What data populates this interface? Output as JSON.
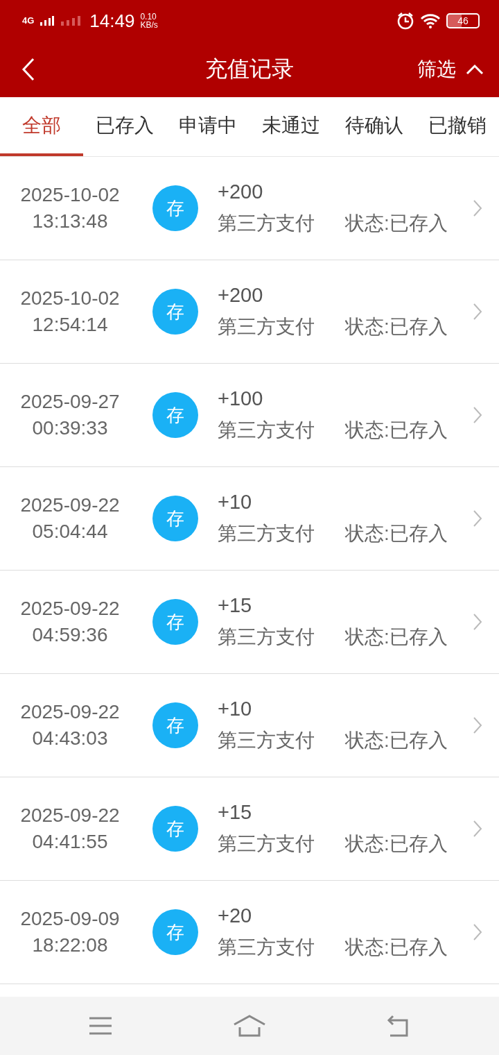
{
  "status_bar": {
    "network": "4G",
    "time": "14:49",
    "speed_value": "0.10",
    "speed_unit": "KB/s",
    "battery": "46"
  },
  "header": {
    "title": "充值记录",
    "filter": "筛选"
  },
  "tabs": [
    {
      "label": "全部",
      "selected": true
    },
    {
      "label": "已存入",
      "selected": false
    },
    {
      "label": "申请中",
      "selected": false
    },
    {
      "label": "未通过",
      "selected": false
    },
    {
      "label": "待确认",
      "selected": false
    },
    {
      "label": "已撤销",
      "selected": false
    }
  ],
  "records": [
    {
      "date": "2025-10-02",
      "time": "13:13:48",
      "badge": "存",
      "amount": "+200",
      "method": "第三方支付",
      "status": "状态:已存入"
    },
    {
      "date": "2025-10-02",
      "time": "12:54:14",
      "badge": "存",
      "amount": "+200",
      "method": "第三方支付",
      "status": "状态:已存入"
    },
    {
      "date": "2025-09-27",
      "time": "00:39:33",
      "badge": "存",
      "amount": "+100",
      "method": "第三方支付",
      "status": "状态:已存入"
    },
    {
      "date": "2025-09-22",
      "time": "05:04:44",
      "badge": "存",
      "amount": "+10",
      "method": "第三方支付",
      "status": "状态:已存入"
    },
    {
      "date": "2025-09-22",
      "time": "04:59:36",
      "badge": "存",
      "amount": "+15",
      "method": "第三方支付",
      "status": "状态:已存入"
    },
    {
      "date": "2025-09-22",
      "time": "04:43:03",
      "badge": "存",
      "amount": "+10",
      "method": "第三方支付",
      "status": "状态:已存入"
    },
    {
      "date": "2025-09-22",
      "time": "04:41:55",
      "badge": "存",
      "amount": "+15",
      "method": "第三方支付",
      "status": "状态:已存入"
    },
    {
      "date": "2025-09-09",
      "time": "18:22:08",
      "badge": "存",
      "amount": "+20",
      "method": "第三方支付",
      "status": "状态:已存入"
    }
  ]
}
